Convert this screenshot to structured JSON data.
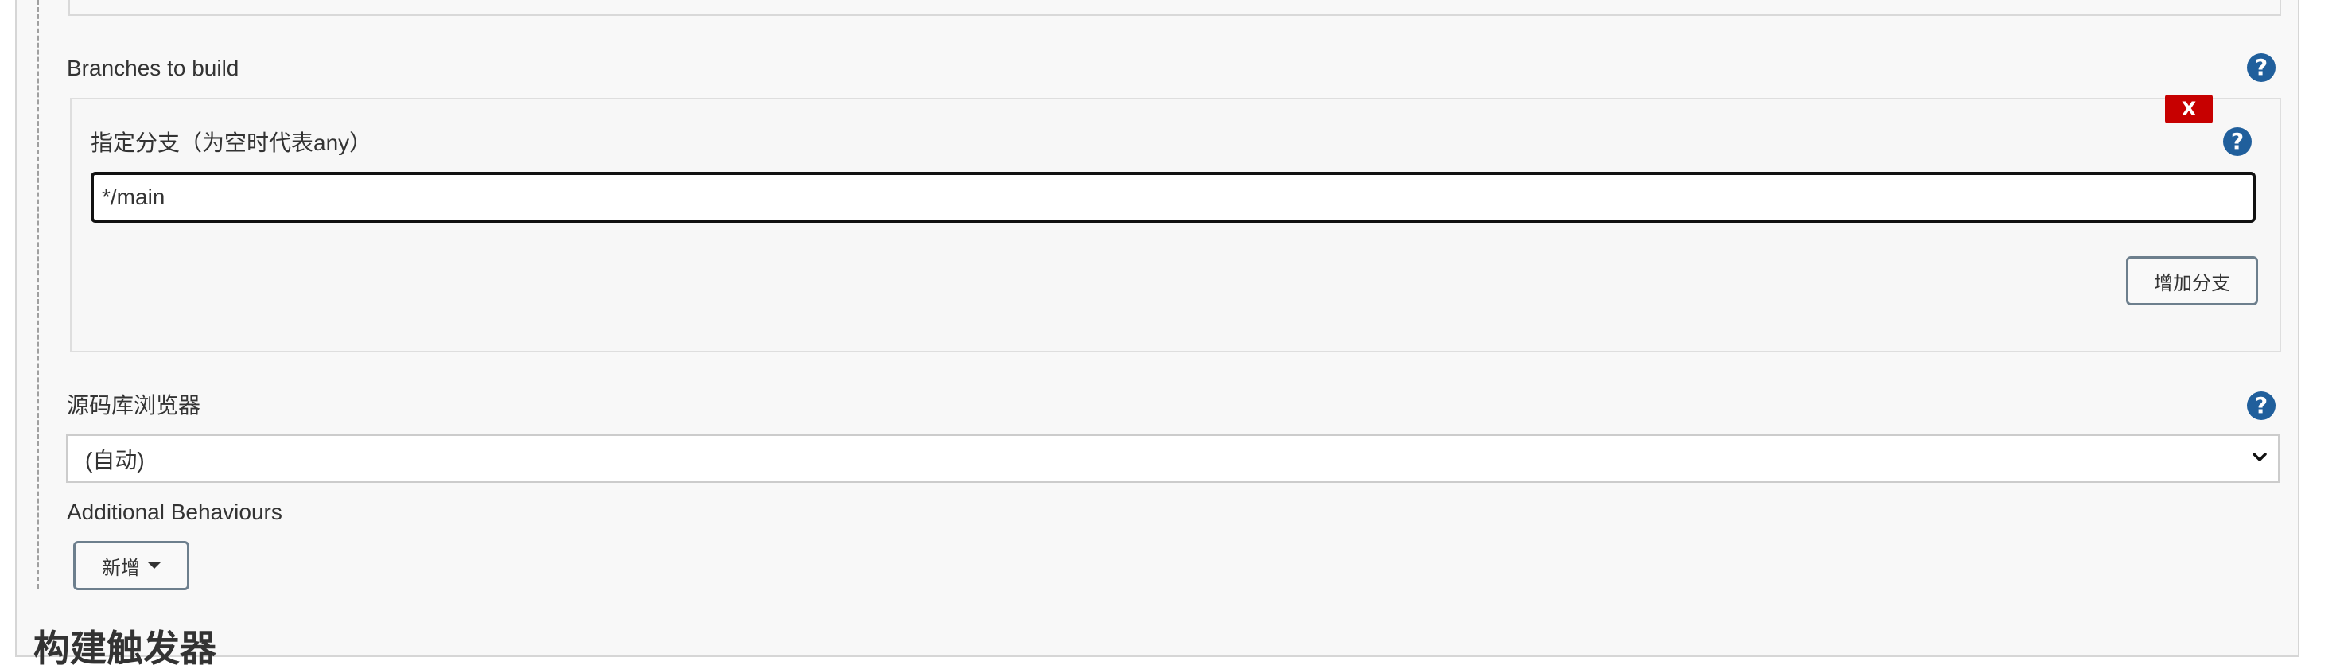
{
  "branches_section": {
    "label": "Branches to build",
    "branch_spec_label": "指定分支（为空时代表any）",
    "branch_spec_value": "*/main",
    "delete_label": "X",
    "add_branch_label": "增加分支"
  },
  "repo_browser": {
    "label": "源码库浏览器",
    "selected_value": "(自动)"
  },
  "additional_behaviours": {
    "label": "Additional Behaviours",
    "add_label": "新增"
  },
  "build_triggers": {
    "heading": "构建触发器"
  },
  "help_icon_glyph": "?",
  "colors": {
    "help_blue": "#205f9c",
    "delete_red": "#c70000",
    "panel_bg": "#f8f8f8"
  }
}
